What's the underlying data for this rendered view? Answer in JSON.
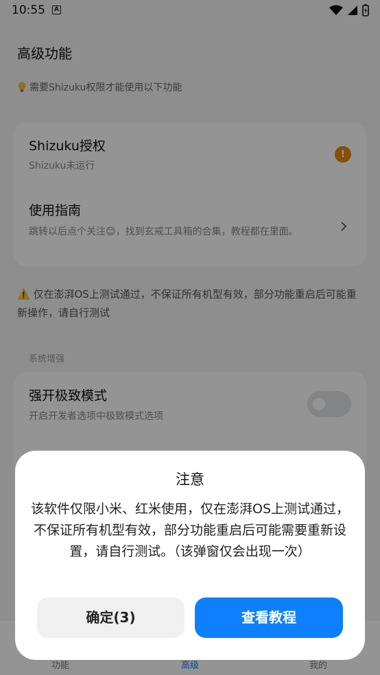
{
  "status_bar": {
    "time": "10:55",
    "notification_letter": "A"
  },
  "page": {
    "title": "高级功能",
    "hint": "需要Shizuku权限才能使用以下功能"
  },
  "card1": {
    "shizuku_title": "Shizuku授权",
    "shizuku_sub": "Shizuku未运行",
    "warn_mark": "!",
    "guide_title": "使用指南",
    "guide_sub": "跳转以后点个关注😊，找到玄戒工具箱的合集，教程都在里面。"
  },
  "notice": "⚠️ 仅在澎湃OS上测试通过，不保证所有机型有效，部分功能重启后可能重新操作，请自行测试",
  "section_label": "系统增强",
  "card2": {
    "extreme_title": "强开极致模式",
    "extreme_sub": "开启开发者选项中极致模式选项",
    "extreme_toggle_on": false
  },
  "bottom_nav": [
    {
      "label": "功能"
    },
    {
      "label": "高级"
    },
    {
      "label": "我的"
    }
  ],
  "dialog": {
    "title": "注意",
    "body": "该软件仅限小米、红米使用，仅在澎湃OS上测试通过，不保证所有机型有效，部分功能重启后可能需要重新设置，请自行测试。（该弹窗仅会出现一次）",
    "confirm_label": "确定(3)",
    "tutorial_label": "查看教程"
  },
  "colors": {
    "accent": "#0d7fff",
    "warning": "#e8890c"
  }
}
